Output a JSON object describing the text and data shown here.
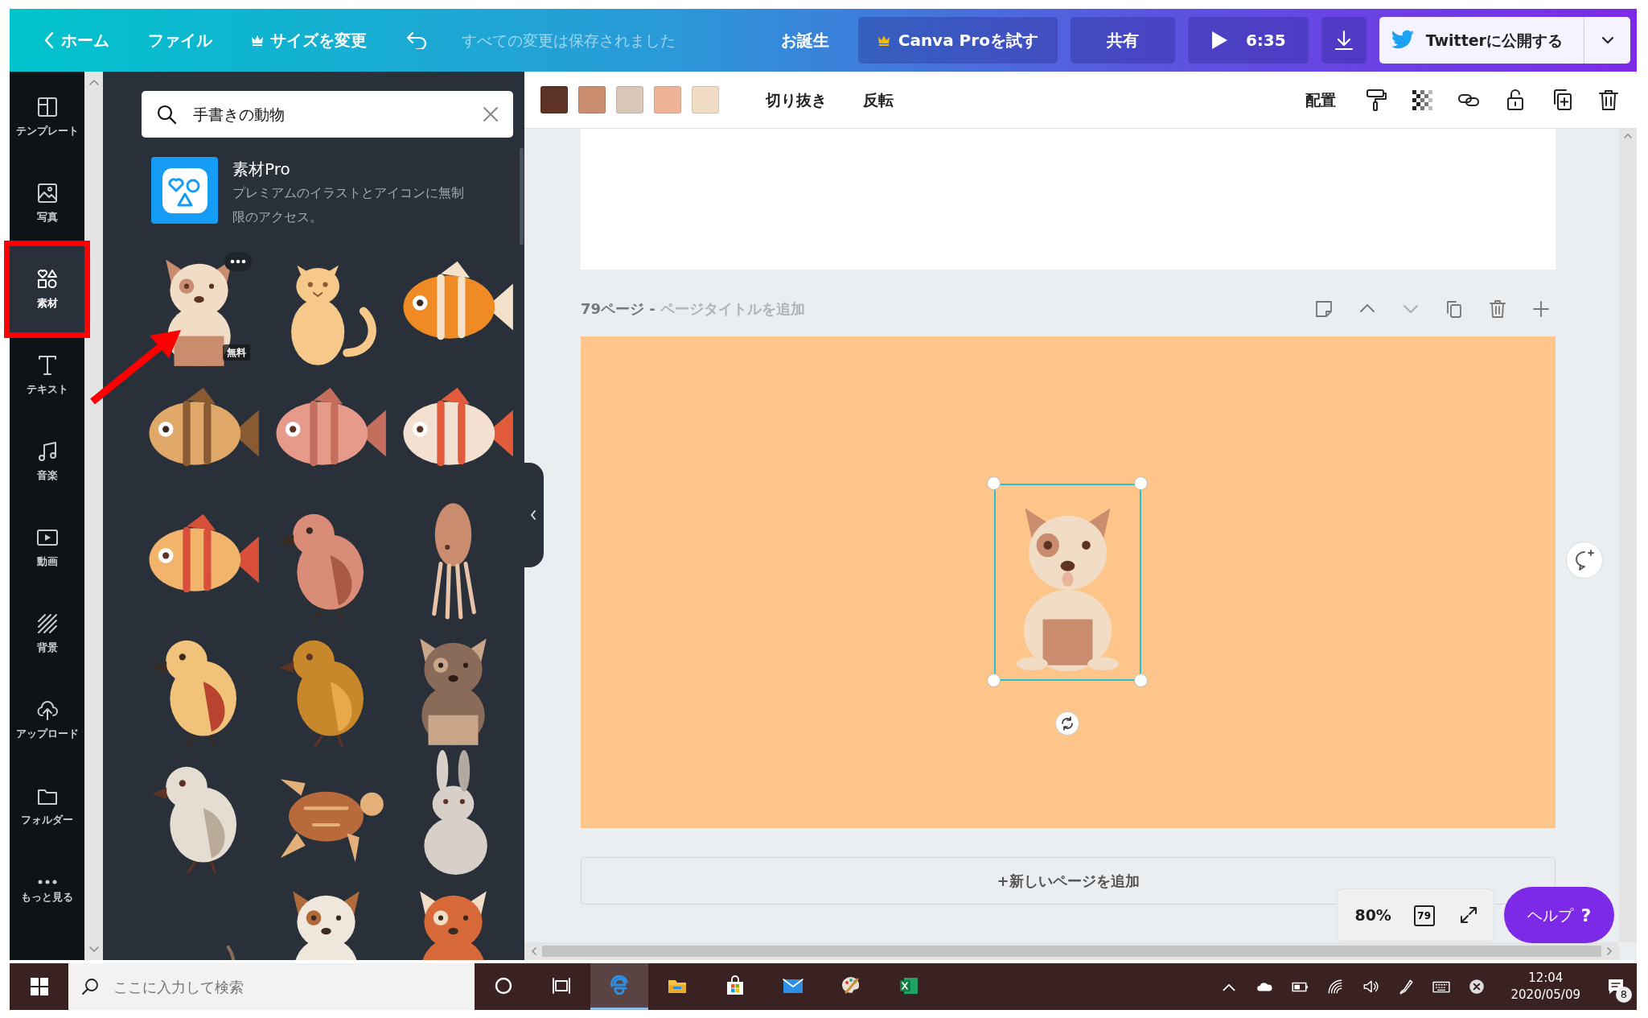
{
  "topbar": {
    "home": "ホーム",
    "file": "ファイル",
    "resize": "サイズを変更",
    "save_status": "すべての変更は保存されました",
    "title": "お誕生",
    "pro_button": "Canva Proを試す",
    "share": "共有",
    "play": "6:35",
    "publish": "Twitterに公開する"
  },
  "sidebar": {
    "items": [
      {
        "kind": "template",
        "label": "テンプレート",
        "selected": false,
        "highlighted": false
      },
      {
        "kind": "photo",
        "label": "写真",
        "selected": false,
        "highlighted": false
      },
      {
        "kind": "elements",
        "label": "素材",
        "selected": true,
        "highlighted": true
      },
      {
        "kind": "text",
        "label": "テキスト",
        "selected": false,
        "highlighted": false
      },
      {
        "kind": "music",
        "label": "音楽",
        "selected": false,
        "highlighted": false
      },
      {
        "kind": "video",
        "label": "動画",
        "selected": false,
        "highlighted": false
      },
      {
        "kind": "background",
        "label": "背景",
        "selected": false,
        "highlighted": false
      },
      {
        "kind": "upload",
        "label": "アップロード",
        "selected": false,
        "highlighted": false
      },
      {
        "kind": "folder",
        "label": "フォルダー",
        "selected": false,
        "highlighted": false
      },
      {
        "kind": "more",
        "label": "もっと見る",
        "selected": false,
        "highlighted": false
      }
    ]
  },
  "annotation_arrow": true,
  "panel": {
    "search": {
      "value": "手書きの動物"
    },
    "promo": {
      "title": "素材Pro",
      "text": "プレミアムのイラストとアイコンに無制限のアクセス。"
    },
    "results": [
      {
        "kind": "dog",
        "badge": "無料"
      },
      {
        "kind": "cat"
      },
      {
        "kind": "fish"
      },
      {
        "kind": "fish"
      },
      {
        "kind": "fish"
      },
      {
        "kind": "fish"
      },
      {
        "kind": "fish"
      },
      {
        "kind": "bird"
      },
      {
        "kind": "squid"
      },
      {
        "kind": "bird"
      },
      {
        "kind": "bird"
      },
      {
        "kind": "dog"
      },
      {
        "kind": "bird"
      },
      {
        "kind": "turtle"
      },
      {
        "kind": "rabbit"
      },
      {
        "kind": "mouse"
      },
      {
        "kind": "dog"
      },
      {
        "kind": "dog"
      }
    ]
  },
  "toolbar": {
    "colors": [
      {
        "color": "#5c3324"
      },
      {
        "color": "#c98c6e"
      },
      {
        "color": "#d9c8b9"
      },
      {
        "color": "#eeb49a"
      },
      {
        "color": "#f1dcc5"
      }
    ],
    "buttons": [
      "切り抜き",
      "反転"
    ],
    "position": "配置"
  },
  "pages": {
    "page_label": "79ページ - ",
    "title_placeholder": "ページタイトルを追加",
    "add_page": "+新しいページを追加"
  },
  "zoom": {
    "value": "80%",
    "page": "79"
  },
  "help": {
    "label": "ヘルプ",
    "mark": "?"
  },
  "taskbar": {
    "search_placeholder": "ここに入力して検索",
    "apps": [
      {
        "kind": "cortana",
        "active": false
      },
      {
        "kind": "taskview",
        "active": false
      },
      {
        "kind": "edge",
        "active": true
      },
      {
        "kind": "explorer",
        "active": false
      },
      {
        "kind": "store",
        "active": false
      },
      {
        "kind": "mail",
        "active": false
      },
      {
        "kind": "paint",
        "active": false
      },
      {
        "kind": "excel",
        "active": false
      }
    ],
    "time": "12:04",
    "date": "2020/05/09",
    "notifications": "8"
  }
}
